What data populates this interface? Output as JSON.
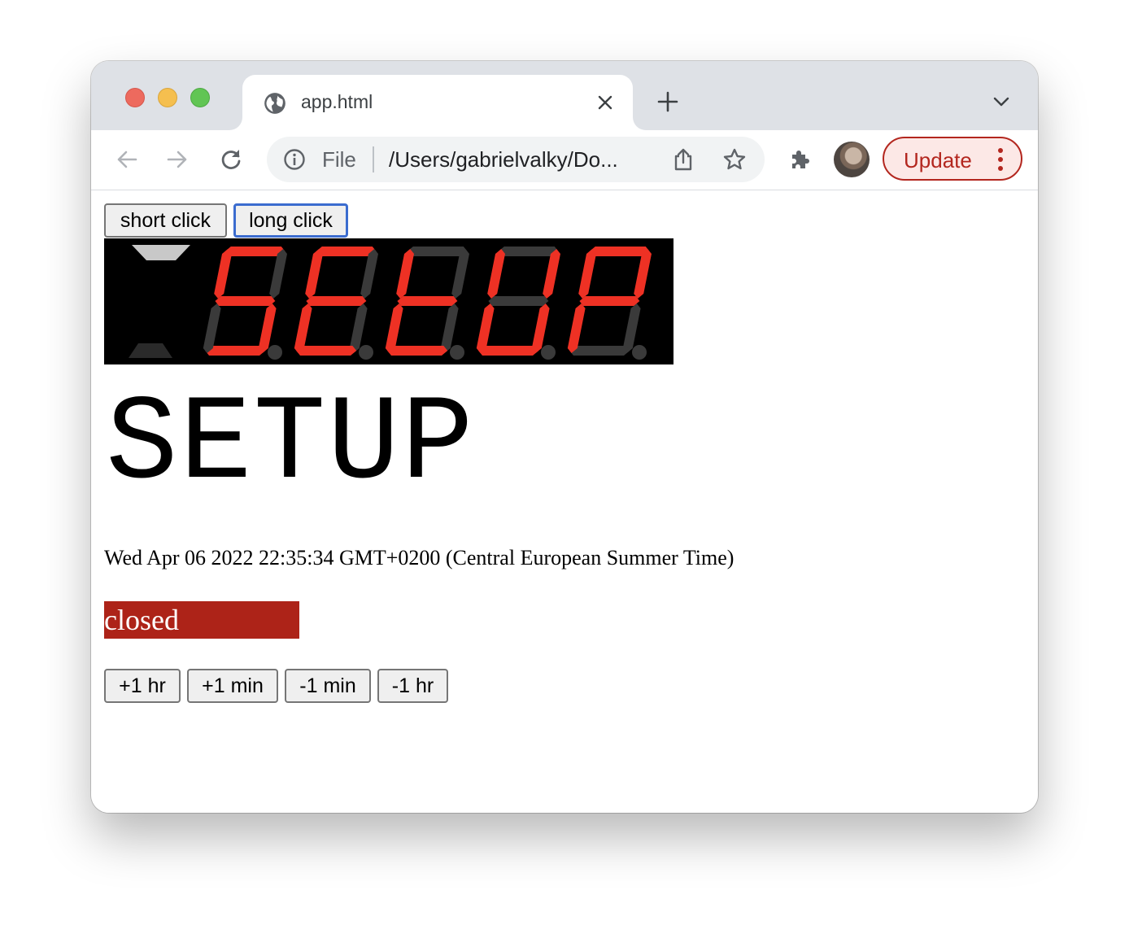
{
  "browser": {
    "tab_title": "app.html",
    "address_scheme": "File",
    "address_url": "/Users/gabrielvalky/Do...",
    "update_label": "Update"
  },
  "page": {
    "buttons_top": {
      "short_click": "short click",
      "long_click": "long click"
    },
    "display": {
      "digits": [
        "5",
        "E",
        "t",
        "U",
        "P"
      ],
      "dots_lit": [
        false,
        false,
        false,
        false,
        false
      ],
      "indicator_top_lit": true,
      "colors": {
        "segment_on": "#ee3124",
        "segment_off": "#3a3a3a",
        "indicator_on": "#c8c8c8",
        "indicator_off": "#2a2a2a",
        "background": "#000000"
      }
    },
    "mode_title": "SETUP",
    "datetime": "Wed Apr 06 2022 22:35:34 GMT+0200 (Central European Summer Time)",
    "status": {
      "label": "closed",
      "color": "#ad2318"
    },
    "adjust_buttons": {
      "plus_hour": "+1 hr",
      "plus_min": "+1 min",
      "minus_min": "-1 min",
      "minus_hour": "-1 hr"
    }
  }
}
